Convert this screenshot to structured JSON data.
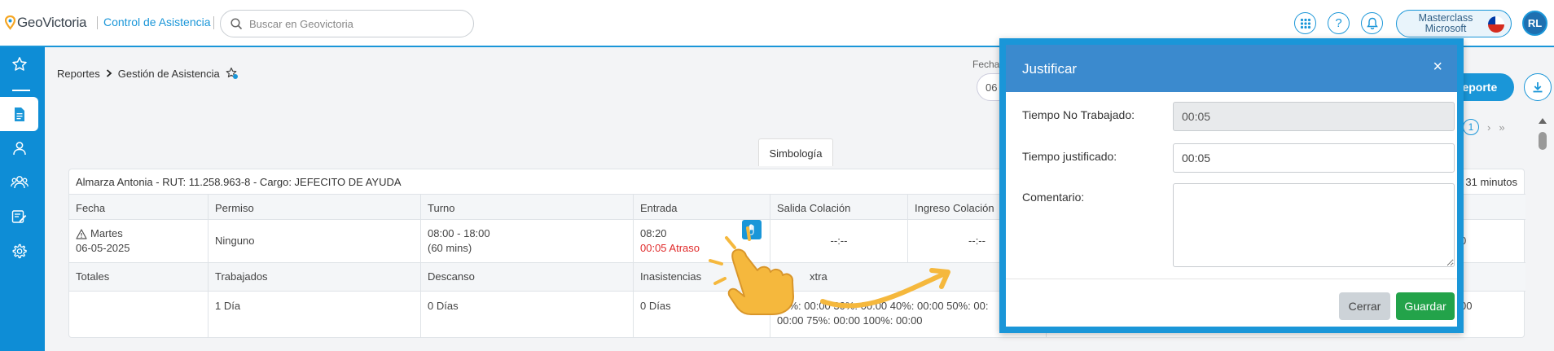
{
  "header": {
    "logo_text": "GeoVictoria",
    "module_name": "Control de Asistencia",
    "search_placeholder": "Buscar en Geovictoria",
    "company_line1": "Masterclass",
    "company_line2": "Microsoft",
    "avatar_initials": "RL"
  },
  "breadcrumb": {
    "parent": "Reportes",
    "current": "Gestión de Asistencia"
  },
  "filters": {
    "fecha_label": "Fecha",
    "fecha_value": "06",
    "report_button": "reporte"
  },
  "pager": {
    "current_page": "1"
  },
  "simbologia_label": "Simbología",
  "employee": {
    "info": "Almarza Antonia - RUT: 11.258.963-8 - Cargo: JEFECITO DE AYUDA",
    "right_text": "31 minutos"
  },
  "table": {
    "headers": [
      "Fecha",
      "Permiso",
      "Turno",
      "Entrada",
      "Salida Colación",
      "Ingreso Colación"
    ],
    "row": {
      "weekday": "Martes",
      "date": "06-05-2025",
      "permiso": "Ninguno",
      "turno": "08:00 - 18:00",
      "turno_detail": "(60 mins)",
      "entrada": "08:20",
      "atraso": "00:05 Atraso",
      "salida_colacion": "--:--",
      "ingreso_colacion": "--:--",
      "right_value": "0"
    },
    "totals_headers": [
      "Totales",
      "Trabajados",
      "Descanso",
      "Inasistencias",
      "xtra"
    ],
    "totals": {
      "trabajados": "1 Día",
      "descanso": "0 Días",
      "inasistencias": "0 Días",
      "extra_line1": "25%: 00:00 30%: 00:00 40%: 00:00 50%: 00:",
      "extra_line2": "00:00 75%: 00:00 100%: 00:00",
      "right_value": "00"
    }
  },
  "modal": {
    "title": "Justificar",
    "close_label": "×",
    "tiempo_no_trabajado_label": "Tiempo No Trabajado:",
    "tiempo_no_trabajado_value": "00:05",
    "tiempo_justificado_label": "Tiempo justificado:",
    "tiempo_justificado_value": "00:05",
    "comentario_label": "Comentario:",
    "comentario_value": "",
    "cancel_label": "Cerrar",
    "save_label": "Guardar"
  },
  "colors": {
    "primary": "#1a96d8",
    "modal_header": "#3b8ace",
    "save_green": "#23a34a",
    "atraso_red": "#e02a2a"
  },
  "icons": [
    "search-icon",
    "apps-grid-icon",
    "help-icon",
    "bell-icon",
    "star-icon",
    "document-icon",
    "user-icon",
    "users-icon",
    "edit-list-icon",
    "gear-icon",
    "download-icon",
    "warning-icon",
    "hand-icon",
    "close-icon"
  ]
}
